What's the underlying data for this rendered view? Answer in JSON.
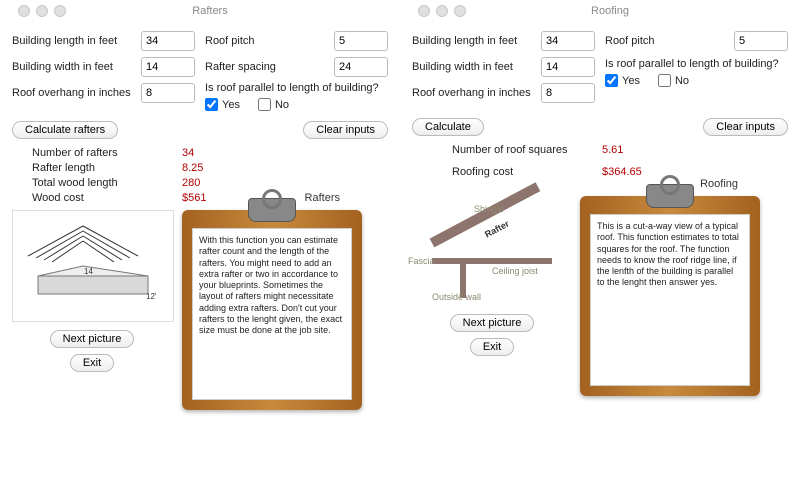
{
  "left": {
    "title": "Rafters",
    "fields": {
      "building_length_label": "Building length in feet",
      "building_length": "34",
      "building_width_label": "Building width in feet",
      "building_width": "14",
      "roof_overhang_label": "Roof overhang in inches",
      "roof_overhang": "8",
      "roof_pitch_label": "Roof pitch",
      "roof_pitch": "5",
      "rafter_spacing_label": "Rafter spacing",
      "rafter_spacing": "24",
      "parallel_question": "Is roof parallel to length of building?",
      "yes": "Yes",
      "no": "No"
    },
    "buttons": {
      "calc": "Calculate rafters",
      "clear": "Clear inputs",
      "next_picture": "Next picture",
      "exit": "Exit"
    },
    "results": {
      "num_rafters_label": "Number of rafters",
      "num_rafters": "34",
      "rafter_length_label": "Rafter length",
      "rafter_length": "8.25",
      "total_wood_label": "Total wood length",
      "total_wood": "280",
      "wood_cost_label": "Wood cost",
      "wood_cost": "$561"
    },
    "clipboard_title": "Rafters",
    "clipboard_text": "With this function you can estimate rafter count and the length of the rafters. You might need to add an extra rafter or two in accordance to your blueprints. Sometimes the layout of rafters might necessitate adding extra rafters. Don't cut your rafters to the lenght given, the exact size must be done at the job site.",
    "diagram_labels": {
      "width": "14",
      "length": "12'"
    }
  },
  "right": {
    "title": "Roofing",
    "fields": {
      "building_length_label": "Building length in feet",
      "building_length": "34",
      "building_width_label": "Building width in feet",
      "building_width": "14",
      "roof_overhang_label": "Roof overhang in inches",
      "roof_overhang": "8",
      "roof_pitch_label": "Roof pitch",
      "roof_pitch": "5",
      "parallel_question": "Is roof parallel to length of building?",
      "yes": "Yes",
      "no": "No"
    },
    "buttons": {
      "calc": "Calculate",
      "clear": "Clear inputs",
      "next_picture": "Next picture",
      "exit": "Exit"
    },
    "results": {
      "roof_squares_label": "Number of roof squares",
      "roof_squares": "5.61",
      "roofing_cost_label": "Roofing cost",
      "roofing_cost": "$364.65"
    },
    "clipboard_title": "Roofing",
    "clipboard_text": "This is a cut-a-way view of a typical roof. This function estimates to total squares for the roof. The function needs to know the roof ridge line, if the lenfth of the building is parallel to the lenght then answer yes.",
    "diagram_labels": {
      "shingle": "Shingle",
      "rafter": "Rafter",
      "ceiling_joist": "Ceiling joist",
      "fascia": "Fascia",
      "outside_wall": "Outside wall"
    }
  }
}
